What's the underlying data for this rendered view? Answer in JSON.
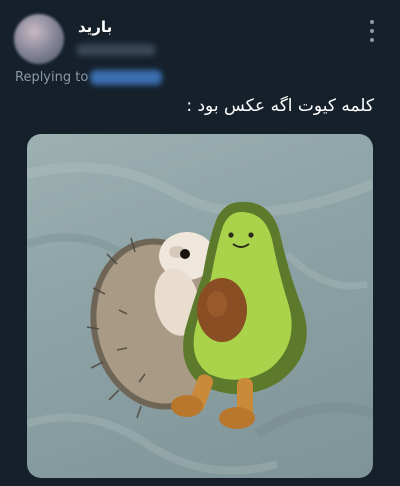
{
  "author": {
    "display_name": "بارید"
  },
  "reply": {
    "prefix": "Replying to"
  },
  "tweet": {
    "text": "کلمه کیوت اگه عکس بود :"
  },
  "icons": {
    "more": "more-vertical-icon"
  },
  "colors": {
    "background": "#15202b",
    "link": "#1d9bf0",
    "secondary_text": "#8b98a5"
  }
}
